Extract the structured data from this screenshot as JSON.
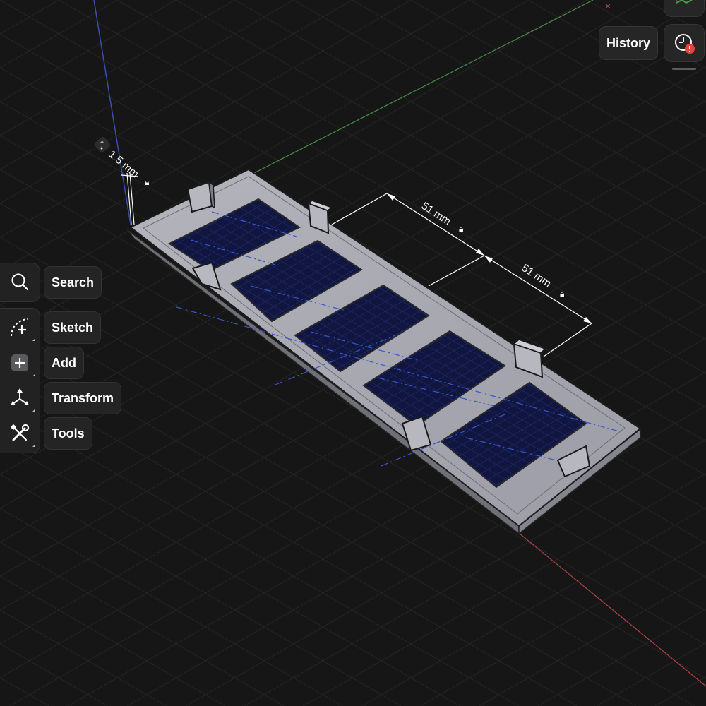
{
  "toolbar": {
    "search": {
      "label": "Search",
      "icon": "search-icon"
    },
    "sketch": {
      "label": "Sketch",
      "icon": "sketch-icon"
    },
    "add": {
      "label": "Add",
      "icon": "add-icon"
    },
    "transform": {
      "label": "Transform",
      "icon": "transform-icon"
    },
    "tools": {
      "label": "Tools",
      "icon": "tools-icon"
    }
  },
  "history": {
    "label": "History",
    "icon": "history-clock-icon",
    "alert_icon": "alert-badge-icon"
  },
  "dimensions": {
    "thickness": "1.5 mm",
    "spacing_1": "51 mm",
    "spacing_2": "51 mm"
  },
  "colors": {
    "background": "#161616",
    "panel": "#262627",
    "model_face": "#a9a9b3",
    "pocket_fill": "#10163f",
    "axis_x": "#b04444",
    "axis_y": "#4a8c4a",
    "axis_z": "#3a4fb0",
    "alert": "#e2453c"
  }
}
